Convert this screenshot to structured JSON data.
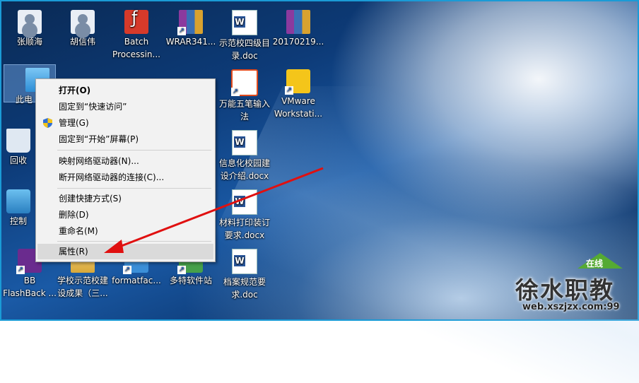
{
  "desktop_icons": [
    {
      "label": "张顺海",
      "icon": "user-folder-icon"
    },
    {
      "label": "胡信伟",
      "icon": "user-folder-icon"
    },
    {
      "label": "Batch Processin...",
      "icon": "batch-app-icon"
    },
    {
      "label": "WRAR341...",
      "icon": "winrar-icon"
    },
    {
      "label": "示范校四级目录.doc",
      "icon": "word-doc-icon"
    },
    {
      "label": "20170219...",
      "icon": "winrar-icon"
    },
    {
      "label": "此电",
      "icon": "this-pc-icon"
    },
    {
      "label": "万能五笔输入法",
      "icon": "wubi-app-icon"
    },
    {
      "label": "VMware Workstati...",
      "icon": "vmware-icon"
    },
    {
      "label": "回收",
      "icon": "recycle-bin-icon"
    },
    {
      "label": "信息化校园建设介绍.docx",
      "icon": "word-doc-icon"
    },
    {
      "label": "控制",
      "icon": "control-panel-icon"
    },
    {
      "label": "材料打印装订要求.docx",
      "icon": "word-doc-icon"
    },
    {
      "label": "BB FlashBack ...",
      "icon": "bb-flashback-icon"
    },
    {
      "label": "学校示范校建设成果（三...",
      "icon": "folder-icon"
    },
    {
      "label": "formatfac...",
      "icon": "format-factory-icon"
    },
    {
      "label": "多特软件站",
      "icon": "duote-icon"
    },
    {
      "label": "档案规范要求.doc",
      "icon": "word-doc-icon"
    }
  ],
  "context_menu": {
    "items": [
      {
        "label": "打开(O)"
      },
      {
        "label": "固定到“快速访问”"
      },
      {
        "label": "管理(G)"
      },
      {
        "label": "固定到“开始”屏幕(P)"
      },
      {
        "label": "映射网络驱动器(N)..."
      },
      {
        "label": "断开网络驱动器的连接(C)..."
      },
      {
        "label": "创建快捷方式(S)"
      },
      {
        "label": "删除(D)"
      },
      {
        "label": "重命名(M)"
      },
      {
        "label": "属性(R)"
      }
    ]
  },
  "watermark": {
    "badge": "在线",
    "title": "徐水职教",
    "url": "web.xszjzx.com:99"
  },
  "colors": {
    "arrow": "#e01010",
    "menu_bg": "#f2f2f2",
    "menu_highlight": "#dadada",
    "frame": "#1a9bd6"
  }
}
